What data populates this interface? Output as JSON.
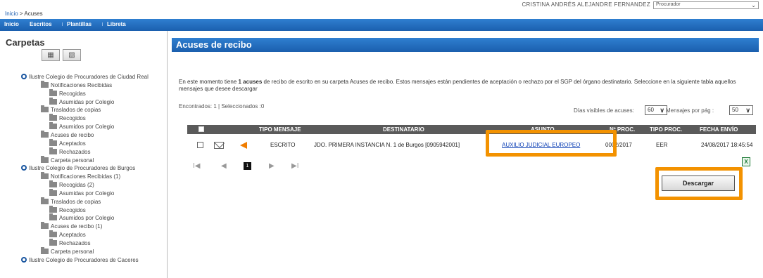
{
  "topbar": {
    "breadcrumb_home": "Inicio",
    "breadcrumb_sep": ">",
    "breadcrumb_current": "Acuses",
    "user_text": "CRISTINA ANDRÉS ALEJANDRE FERNANDEZ",
    "profile_select": "Procurador"
  },
  "nav": {
    "items": [
      "Inicio",
      "Escritos",
      "Plantillas",
      "Libreta"
    ]
  },
  "sidebar": {
    "title": "Carpetas",
    "buttons": [
      "expand-folders-icon",
      "collapse-folders-icon"
    ],
    "tree": [
      {
        "level": 0,
        "type": "bullet",
        "label": "Ilustre Colegio de Procuradores de Ciudad Real"
      },
      {
        "level": 1,
        "type": "folder",
        "label": "Notificaciones Recibidas"
      },
      {
        "level": 2,
        "type": "folder",
        "label": "Recogidas"
      },
      {
        "level": 2,
        "type": "folder",
        "label": "Asumidas por Colegio"
      },
      {
        "level": 1,
        "type": "folder",
        "label": "Traslados de copias"
      },
      {
        "level": 2,
        "type": "folder",
        "label": "Recogidos"
      },
      {
        "level": 2,
        "type": "folder",
        "label": "Asumidos por Colegio"
      },
      {
        "level": 1,
        "type": "folder",
        "label": "Acuses de recibo"
      },
      {
        "level": 2,
        "type": "folder",
        "label": "Aceptados"
      },
      {
        "level": 2,
        "type": "folder",
        "label": "Rechazados"
      },
      {
        "level": 1,
        "type": "folder",
        "label": "Carpeta personal"
      },
      {
        "level": 0,
        "type": "bullet",
        "label": "Ilustre Colegio de Procuradores de Burgos"
      },
      {
        "level": 1,
        "type": "folder",
        "label": "Notificaciones Recibidas (1)"
      },
      {
        "level": 2,
        "type": "folder",
        "label": "Recogidas (2)"
      },
      {
        "level": 2,
        "type": "folder",
        "label": "Asumidas por Colegio"
      },
      {
        "level": 1,
        "type": "folder",
        "label": "Traslados de copias"
      },
      {
        "level": 2,
        "type": "folder",
        "label": "Recogidos"
      },
      {
        "level": 2,
        "type": "folder",
        "label": "Asumidos por Colegio"
      },
      {
        "level": 1,
        "type": "folder",
        "label": "Acuses de recibo (1)"
      },
      {
        "level": 2,
        "type": "folder",
        "label": "Aceptados"
      },
      {
        "level": 2,
        "type": "folder",
        "label": "Rechazados"
      },
      {
        "level": 1,
        "type": "folder",
        "label": "Carpeta personal"
      },
      {
        "level": 0,
        "type": "bullet",
        "label": "Ilustre Colegio de Procuradores de Caceres"
      }
    ]
  },
  "main": {
    "title": "Acuses de recibo",
    "intro_pre": "En este momento tiene ",
    "intro_bold": "1 acuses",
    "intro_post": " de recibo de escrito en su carpeta Acuses de recibo. Estos mensajes están pendientes de aceptación o rechazo por el SGP del órgano destinatario. Seleccione en la siguiente tabla aquellos mensajes que desee descargar",
    "found_text": "Encontrados: 1 | Seleccionados :0",
    "visible_days_label": "Días visibles de acuses:",
    "visible_days_value": "60",
    "per_page_label": "Mensajes por pág :",
    "per_page_value": "50",
    "columns": [
      "TIPO MENSAJE",
      "DESTINATARIO",
      "ASUNTO",
      "Nº PROC.",
      "TIPO PROC.",
      "FECHA ENVÍO"
    ],
    "rows": [
      {
        "tipo": "ESCRITO",
        "destinatario": "JDO. PRIMERA INSTANCIA N. 1 de Burgos [0905942001]",
        "asunto": "AUXILIO JUDICIAL EUROPEO",
        "num_proc": "0002/2017",
        "tipo_proc": "EER",
        "fecha": "24/08/2017 18:45:54"
      }
    ],
    "pager": {
      "first": "I◀",
      "prev": "◀",
      "current": "1",
      "next": "▶",
      "last": "▶I"
    },
    "excel_label": "X",
    "download_label": "Descargar"
  },
  "highlight_color": "#f39200"
}
